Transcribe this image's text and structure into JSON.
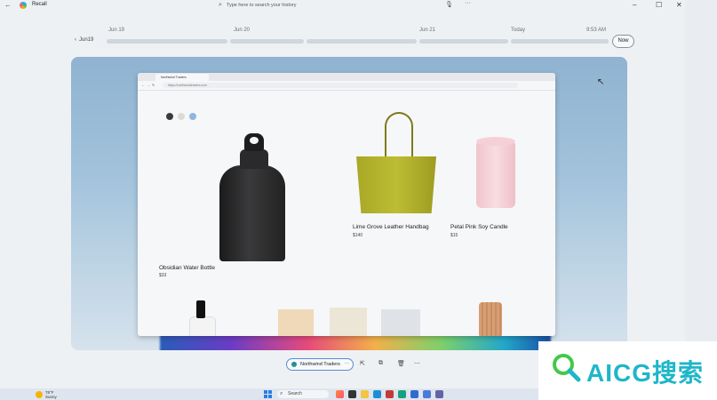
{
  "window": {
    "title": "Recall",
    "search_placeholder": "Type here to search your history"
  },
  "timeline": {
    "back_label": "Jun19",
    "dates": [
      "Jun 19",
      "Jun 20",
      "Jun 21",
      "Today",
      "9:53 AM"
    ],
    "now_label": "Now"
  },
  "browser": {
    "tab_title": "Northwind Traders",
    "url": "https://northwindtraders.com"
  },
  "products": [
    {
      "name": "Obsidian  Water Bottle",
      "price": "$33"
    },
    {
      "name": "Lime Grove Leather Handbag",
      "price": "$140"
    },
    {
      "name": "Petal Pink Soy Candle",
      "price": "$15"
    }
  ],
  "swatches": [
    "#3b3b3b",
    "#dcdcd6",
    "#8fb6dc"
  ],
  "toolbar": {
    "chip_label": "Northwind Traders",
    "chip_more": "⋯",
    "more": "⋯"
  },
  "taskbar": {
    "weather_temp": "78°F",
    "weather_desc": "Sunny",
    "search_label": "Search"
  },
  "watermark": {
    "text": "AICG搜索"
  }
}
